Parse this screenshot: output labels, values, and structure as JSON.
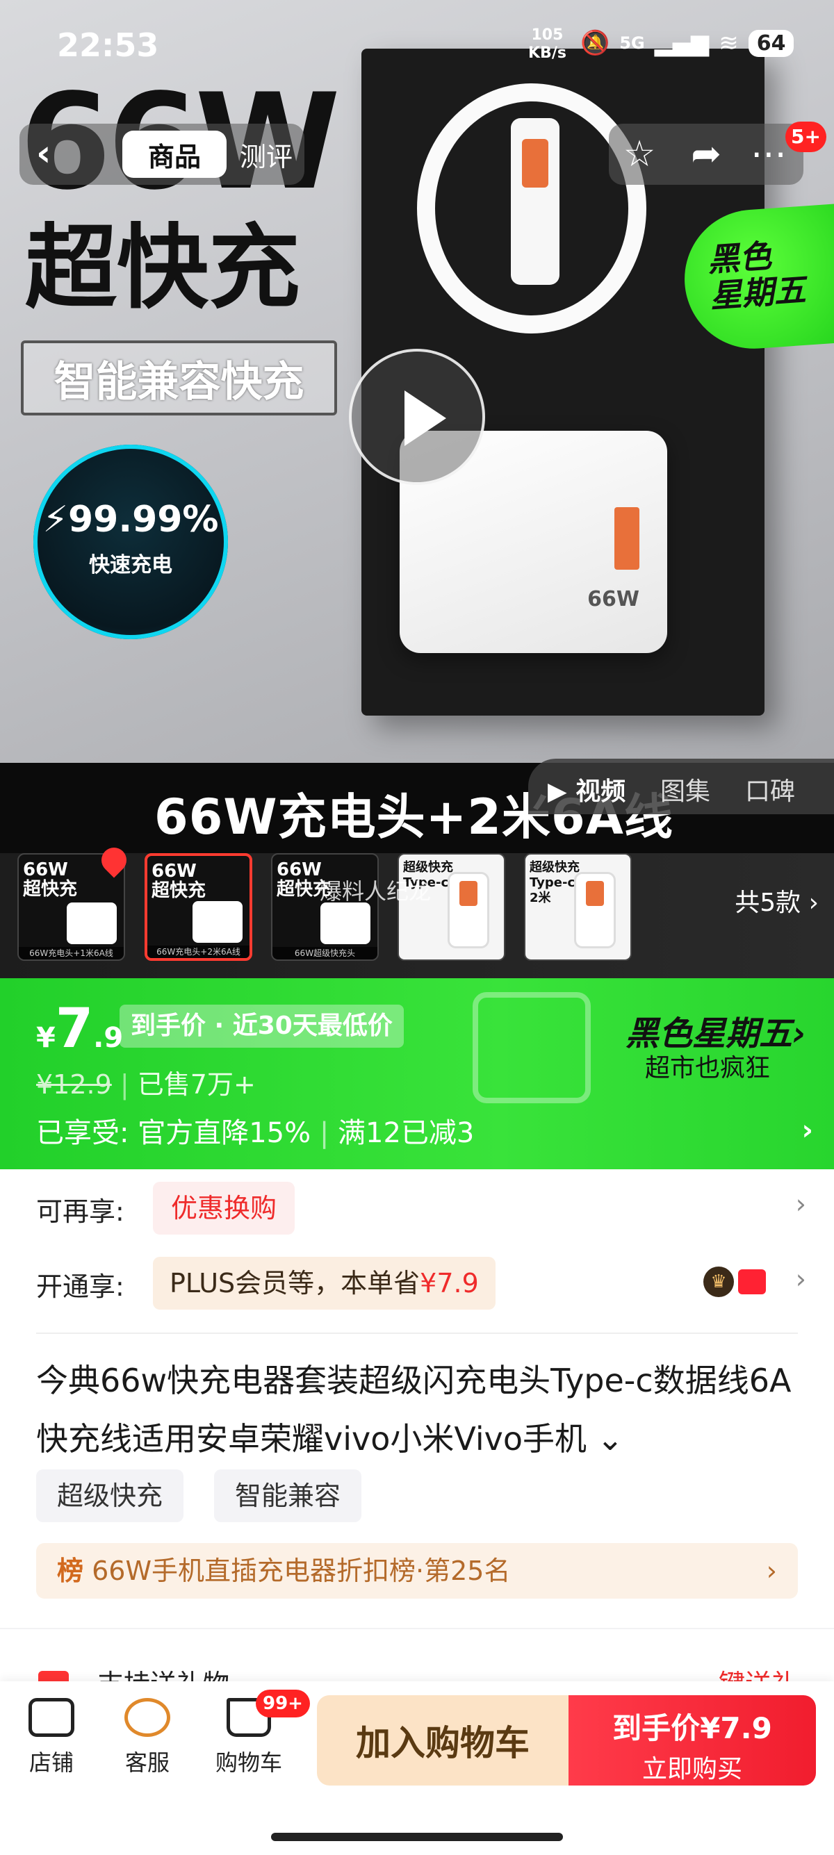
{
  "status_bar": {
    "time": "22:53",
    "net_speed_value": "105",
    "net_speed_unit": "KB/s",
    "network": "5G",
    "battery": "64"
  },
  "hero": {
    "headline_large": "66W",
    "headline_sub": "超快充",
    "compat_label": "智能兼容快充",
    "badge_pct": "99.99%",
    "badge_label": "快速充电",
    "charger_mark": "66W",
    "promo_sticker_line1": "黑色",
    "promo_sticker_line2": "星期五"
  },
  "top_nav": {
    "tabs": [
      {
        "label": "商品",
        "active": true
      },
      {
        "label": "测评",
        "active": false
      }
    ],
    "message_badge": "5+"
  },
  "product_band": {
    "text": "66W充电头+2米6A线"
  },
  "media_tabs": [
    {
      "label": "视频",
      "active": true
    },
    {
      "label": "图集",
      "active": false
    },
    {
      "label": "口碑",
      "active": false
    }
  ],
  "variants": {
    "items": [
      {
        "title": "66W\n超快充",
        "caption": "66W充电头+1米6A线"
      },
      {
        "title": "66W\n超快充",
        "caption": "66W充电头+2米6A线"
      },
      {
        "title": "66W\n超快充",
        "caption": "66W超级快充头"
      },
      {
        "title": "超级快充\nType-c线",
        "caption": ""
      },
      {
        "title": "超级快充\nType-c线\n2米",
        "caption": ""
      }
    ],
    "watermark": "爆料人纪龙",
    "count_label": "共5款"
  },
  "price_banner": {
    "currency": "¥",
    "price_int": "7",
    "price_dec": ".9",
    "lowest_label": "到手价 · 近30天最低价",
    "original_price": "¥12.9",
    "sold": "已售7万+",
    "enjoy_label": "已享受:",
    "enjoy_detail_1": "官方直降15%",
    "enjoy_detail_2": "满12已减3",
    "event_title": "黑色星期五",
    "event_sub": "超市也疯狂"
  },
  "offers": {
    "more_label": "可再享:",
    "more_pill": "优惠换购",
    "open_label": "开通享:",
    "open_pill_prefix": "PLUS会员等，本单省",
    "open_pill_amount": "¥7.9"
  },
  "product": {
    "title": "今典66w快充电器套装超级闪充电头Type-c数据线6A快充线适用安卓荣耀vivo小米Vivo手机",
    "tags": [
      "超级快充",
      "智能兼容"
    ],
    "rank_badge": "榜",
    "rank_text": "66W手机直插充电器折扣榜·第25名"
  },
  "peek_section": {
    "left": "支持送礼物",
    "right": "一键送礼"
  },
  "bottom_bar": {
    "shop_label": "店铺",
    "service_label": "客服",
    "cart_label": "购物车",
    "cart_badge": "99+",
    "add_to_cart": "加入购物车",
    "buy_price": "到手价¥7.9",
    "buy_now": "立即购买"
  }
}
